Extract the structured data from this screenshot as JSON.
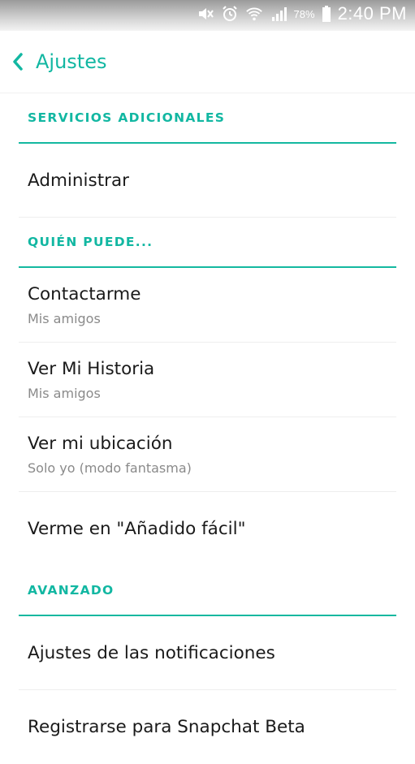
{
  "status_bar": {
    "battery_percent": "78%",
    "time": "2:40 PM",
    "icons": [
      "mute-icon",
      "alarm-icon",
      "wifi-icon",
      "signal-icon",
      "battery-icon"
    ]
  },
  "header": {
    "back_icon": "chevron-left-icon",
    "title": "Ajustes",
    "accent_color": "#12b7a2"
  },
  "sections": [
    {
      "title": "SERVICIOS ADICIONALES",
      "items": [
        {
          "label": "Administrar"
        }
      ]
    },
    {
      "title": "QUIÉN PUEDE...",
      "items": [
        {
          "label": "Contactarme",
          "value": "Mis amigos"
        },
        {
          "label": "Ver Mi Historia",
          "value": "Mis amigos"
        },
        {
          "label": "Ver mi ubicación",
          "value": "Solo yo (modo fantasma)"
        },
        {
          "label": "Verme en \"Añadido fácil\""
        }
      ]
    },
    {
      "title": "AVANZADO",
      "items": [
        {
          "label": "Ajustes de las notificaciones"
        },
        {
          "label": "Registrarse para Snapchat Beta"
        }
      ]
    }
  ]
}
